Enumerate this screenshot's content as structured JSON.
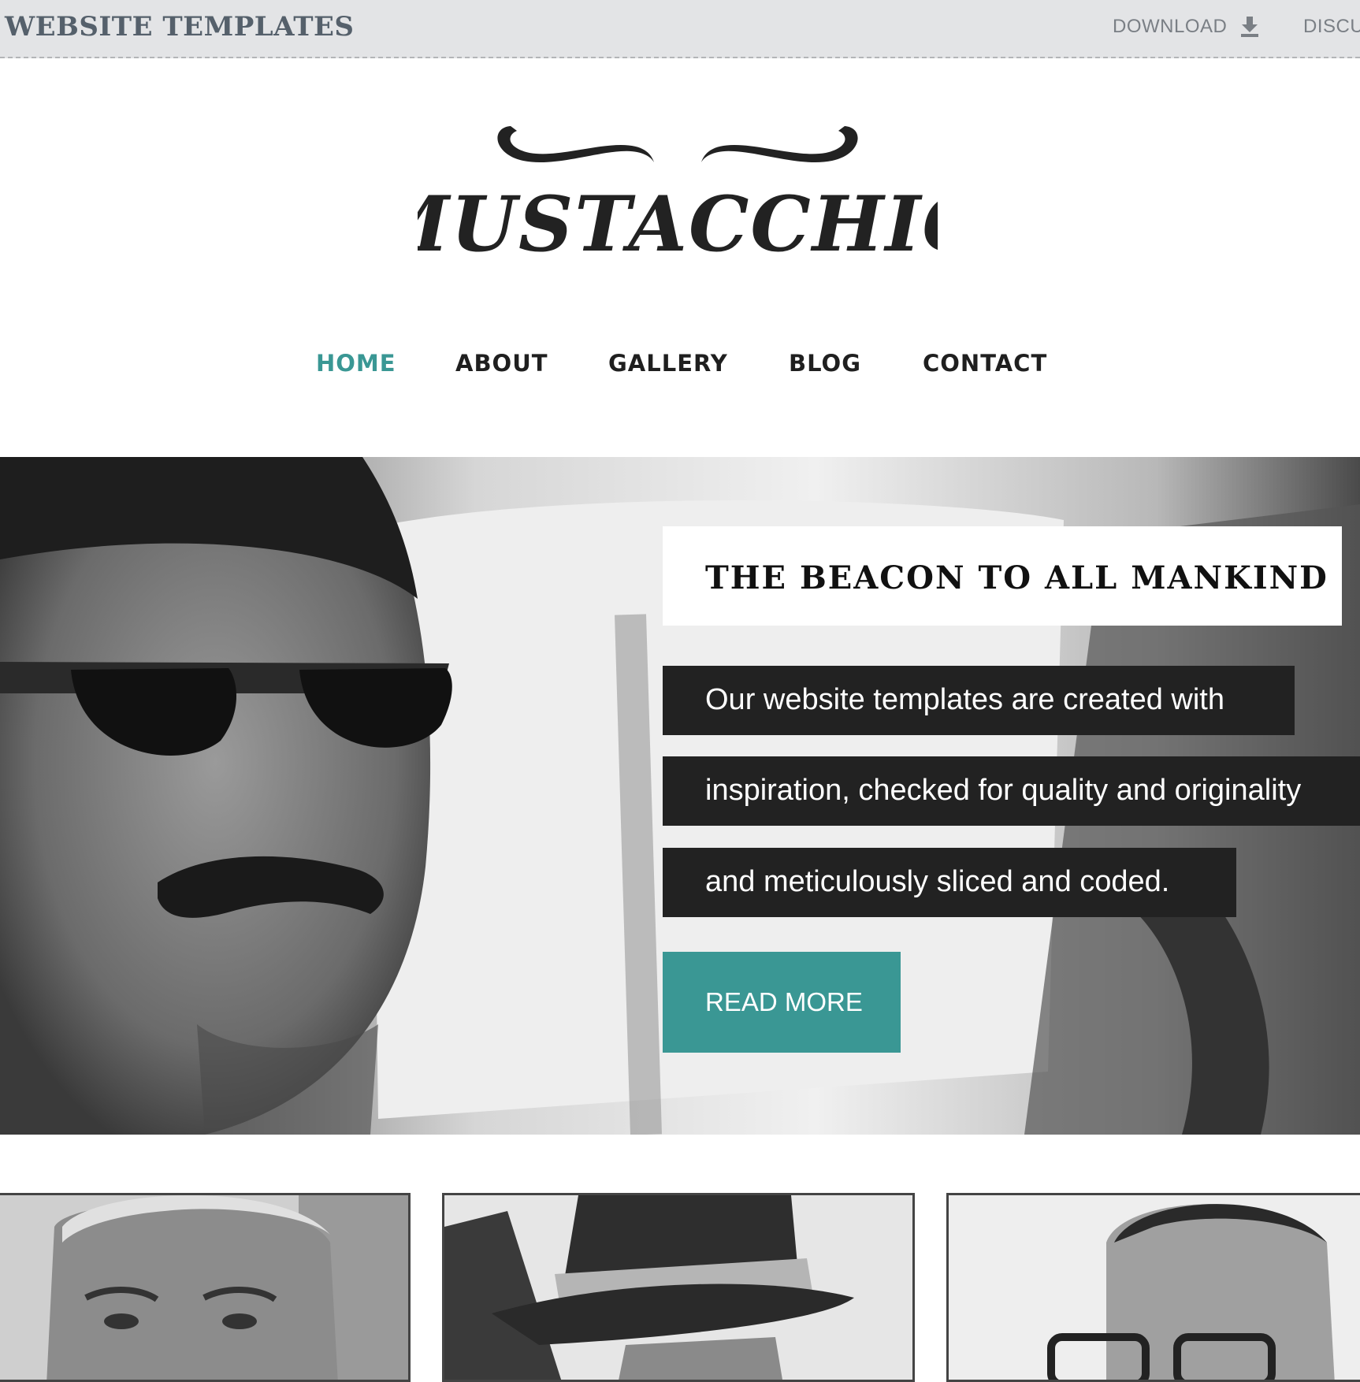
{
  "topbar": {
    "brand": "WEBSITE TEMPLATES",
    "download_label": "DOWNLOAD",
    "download_icon": "download-arrow-icon",
    "discuss_label": "DISCU"
  },
  "logo": {
    "text": "MUSTACCHIO",
    "icon": "mustache-icon"
  },
  "nav": {
    "items": [
      {
        "label": "HOME",
        "active": true
      },
      {
        "label": "ABOUT",
        "active": false
      },
      {
        "label": "GALLERY",
        "active": false
      },
      {
        "label": "BLOG",
        "active": false
      },
      {
        "label": "CONTACT",
        "active": false
      }
    ]
  },
  "hero": {
    "title": "THE BEACON TO ALL MANKIND",
    "lines": [
      "Our website templates are created with",
      "inspiration, checked for quality and originality",
      "and meticulously sliced and coded."
    ],
    "button_label": "READ MORE"
  },
  "colors": {
    "accent": "#3a9794",
    "dark_box": "#222222",
    "topbar_bg": "#e3e4e6",
    "nav_text": "#1f1f1f"
  }
}
